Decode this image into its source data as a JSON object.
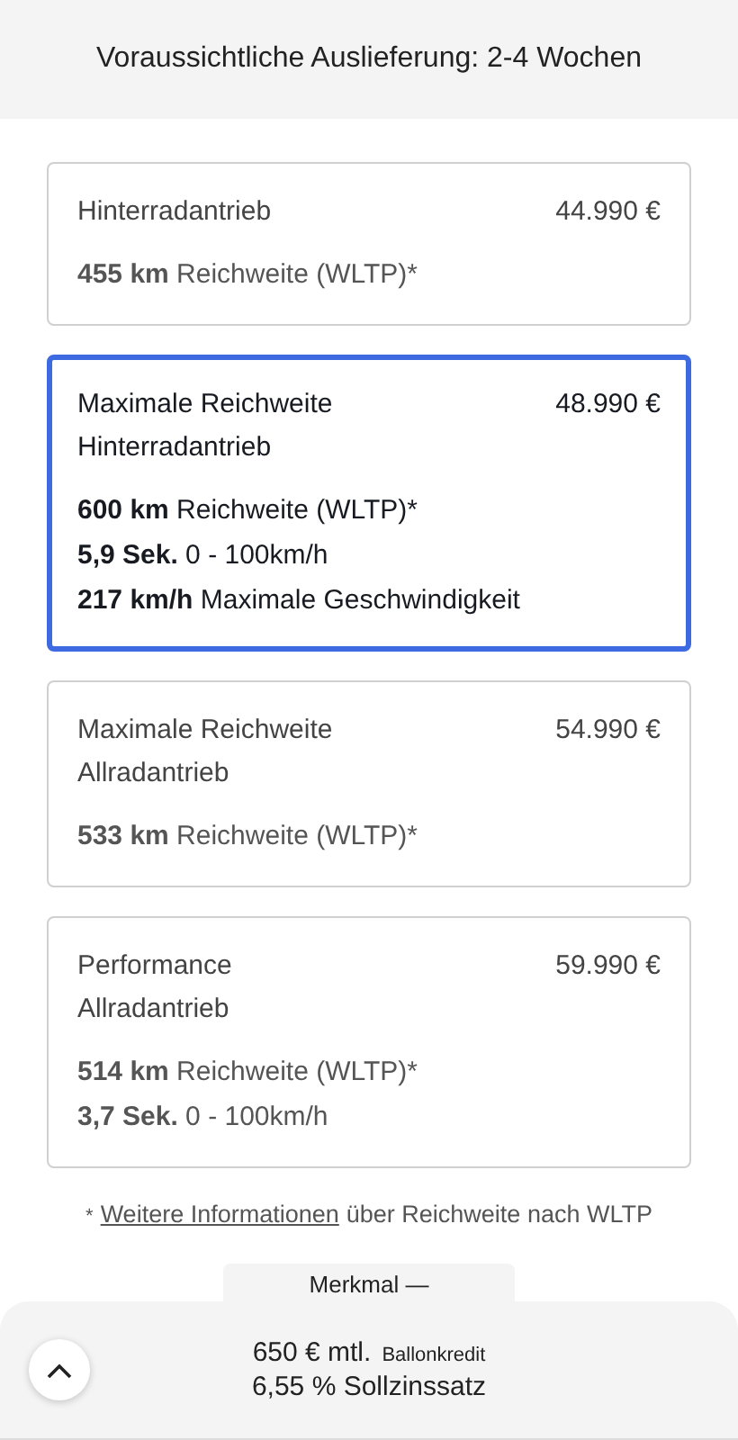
{
  "header": {
    "delivery": "Voraussichtliche Auslieferung: 2-4 Wochen"
  },
  "variants": [
    {
      "name": "Hinterradantrieb",
      "price": "44.990 €",
      "selected": false,
      "specs": [
        "**455 km** Reichweite (WLTP)*"
      ]
    },
    {
      "name": "Maximale Reichweite\nHinterradantrieb",
      "price": "48.990 €",
      "selected": true,
      "specs": [
        "**600 km** Reichweite (WLTP)*",
        "**5,9 Sek.** 0 - 100km/h",
        "**217 km/h** Maximale Geschwindigkeit"
      ]
    },
    {
      "name": "Maximale Reichweite\nAllradantrieb",
      "price": "54.990 €",
      "selected": false,
      "specs": [
        "**533 km** Reichweite (WLTP)*"
      ]
    },
    {
      "name": "Performance\nAllradantrieb",
      "price": "59.990 €",
      "selected": false,
      "specs": [
        "**514 km** Reichweite (WLTP)*",
        "**3,7 Sek.** 0 - 100km/h"
      ]
    }
  ],
  "footnote": {
    "mark": "*",
    "link": "Weitere Informationen",
    "text": "über Reichweite nach WLTP"
  },
  "feature_tab": "Merkmal —",
  "financing": {
    "monthly": "650 € mtl.",
    "type": "Ballonkredit",
    "rate": "6,55 % Sollzinssatz"
  }
}
